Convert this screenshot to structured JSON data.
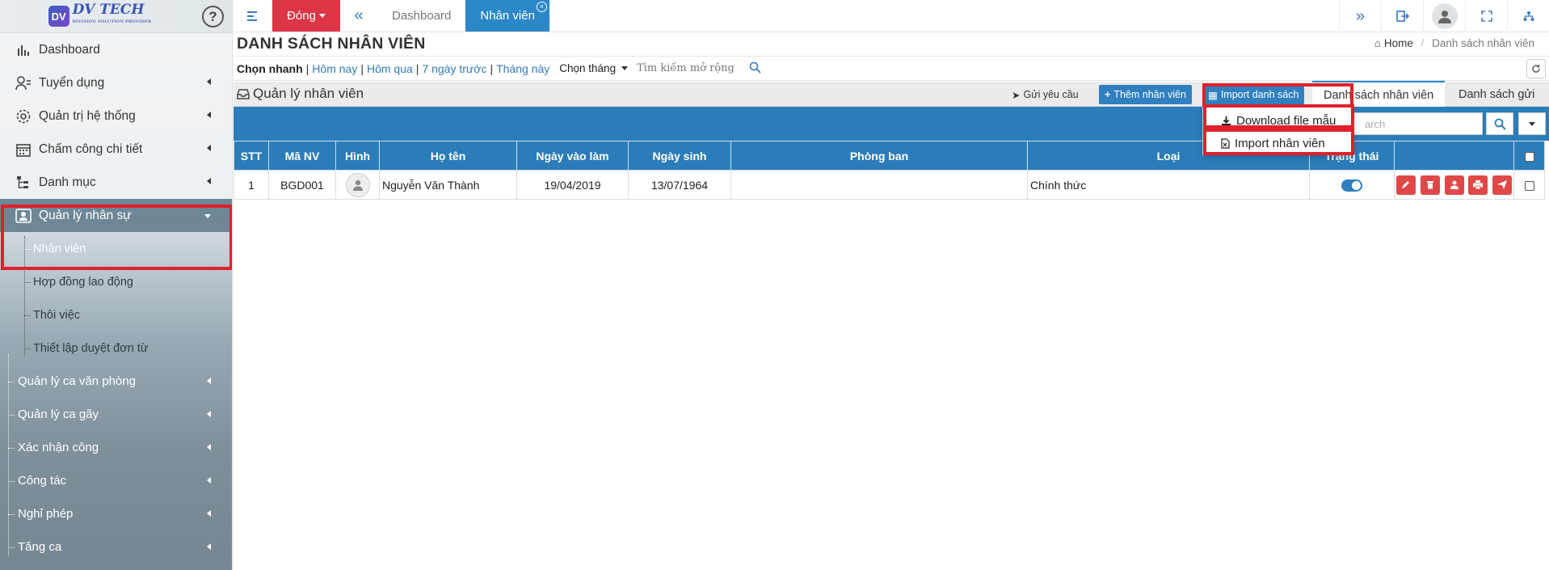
{
  "sidebar": {
    "logo": {
      "text": "DV TECH",
      "sub": "DIVISION SOLUTION PROVIDER"
    },
    "help_label": "?",
    "items": [
      {
        "label": "Dashboard"
      },
      {
        "label": "Tuyển dụng"
      },
      {
        "label": "Quản trị hệ thống"
      },
      {
        "label": "Chấm công chi tiết"
      },
      {
        "label": "Danh mục"
      },
      {
        "label": "Quản lý nhân sự"
      }
    ],
    "sub_items": [
      {
        "label": "Nhân viên"
      },
      {
        "label": "Hợp đồng lao động"
      },
      {
        "label": "Thôi việc"
      },
      {
        "label": "Thiết lập duyệt đơn từ"
      }
    ],
    "lower_items": [
      {
        "label": "Quản lý ca văn phòng"
      },
      {
        "label": "Quản lý ca gãy"
      },
      {
        "label": "Xác nhận công"
      },
      {
        "label": "Công tác"
      },
      {
        "label": "Nghỉ phép"
      },
      {
        "label": "Tăng ca"
      }
    ]
  },
  "topbar": {
    "close_label": "Đóng",
    "tabs": [
      {
        "label": "Dashboard"
      },
      {
        "label": "Nhân viên"
      }
    ]
  },
  "page": {
    "title": "DANH SÁCH NHÂN VIÊN",
    "breadcrumb": {
      "home": "Home",
      "current": "Danh sách nhân viên"
    }
  },
  "quick_filter": {
    "label": "Chọn nhanh",
    "links": [
      "Hôm nay",
      "Hôm qua",
      "7 ngày trước",
      "Tháng này"
    ],
    "month_label": "Chọn tháng",
    "search_placeholder": "Tìm kiếm mở rộng"
  },
  "panel": {
    "title": "Quản lý nhân viên",
    "send_request": "Gửi yêu cầu",
    "add_employee": "Thêm nhân viên",
    "import_list": "Import danh sách",
    "tabs": [
      "Danh sách nhân viên",
      "Danh sách gửi"
    ]
  },
  "toolbar": {
    "search_placeholder": "arch"
  },
  "dropdown": {
    "items": [
      "Download file mẫu",
      "Import nhân viên"
    ]
  },
  "table": {
    "columns": [
      "STT",
      "Mã NV",
      "Hình",
      "Họ tên",
      "Ngày vào làm",
      "Ngày sinh",
      "Phòng ban",
      "Loại",
      "Trạng thái",
      "",
      ""
    ],
    "rows": [
      {
        "stt": "1",
        "code": "BGD001",
        "name": "Nguyễn Văn Thành",
        "start": "19/04/2019",
        "dob": "13/07/1964",
        "dept": "",
        "type": "Chính thức",
        "active": true
      }
    ]
  },
  "colors": {
    "primary": "#2b7dba",
    "danger": "#dc3545",
    "action": "#e04848",
    "highlight": "#e0202c"
  }
}
